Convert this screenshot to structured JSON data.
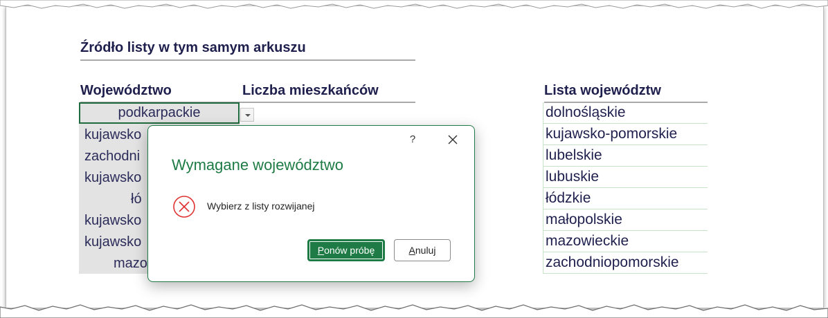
{
  "section": {
    "title": "Źródło listy w tym samym arkuszu"
  },
  "headers": {
    "wojewodztwo": "Województwo",
    "liczba": "Liczba mieszkańców",
    "lista": "Lista województw"
  },
  "cells": {
    "active": "podkarpackie",
    "rows": [
      "kujawsko",
      "zachodni",
      "kujawsko",
      "łó",
      "kujawsko",
      "kujawsko",
      "mazo"
    ]
  },
  "list_items": [
    "dolnośląskie",
    "kujawsko-pomorskie",
    "lubelskie",
    "lubuskie",
    "łódzkie",
    "małopolskie",
    "mazowieckie",
    "zachodniopomorskie"
  ],
  "dialog": {
    "help_label": "?",
    "title": "Wymagane województwo",
    "message": "Wybierz z listy rozwijanej",
    "retry_mnemonic": "P",
    "retry_rest": "onów próbę",
    "cancel_mnemonic": "A",
    "cancel_rest": "nuluj",
    "icons": [
      "close-icon",
      "error-icon",
      "dropdown-arrow-icon"
    ]
  },
  "colors": {
    "accent": "#1e7b45",
    "header_text": "#1f1f4e",
    "cell_fill": "#e3e3e3",
    "error": "#e03131"
  }
}
